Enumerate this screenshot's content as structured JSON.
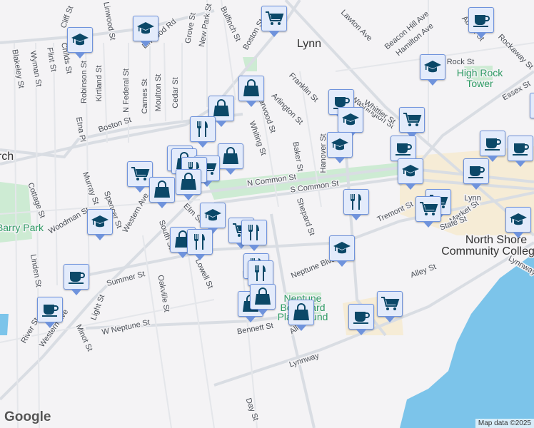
{
  "map": {
    "city_label": "Lynn",
    "landmark": [
      "High Rock",
      "Tower"
    ],
    "station": "Lynn",
    "college": [
      "North Shore",
      "Community College"
    ],
    "park_barry": "Barry Park",
    "playground": [
      "Neptune",
      "Boulevard",
      "Playground"
    ],
    "church_partial": "rch",
    "streets": [
      "Boston St",
      "Boston St",
      "N Common St",
      "S Common St",
      "Western Ave",
      "Summer St",
      "Neptune Blvd",
      "Lynnway",
      "Lynnway",
      "W Neptune St",
      "Bennett St",
      "Alley St",
      "Alley St",
      "Washington St",
      "Essex St",
      "Whittier St",
      "Franklin St",
      "Arlington St",
      "Harwood St",
      "Whiting St",
      "Baker St",
      "Hanover St",
      "Shepard St",
      "Lawton Ave",
      "Beacon Hill Ave",
      "Hamilton Ave",
      "Acorn St",
      "Rock St",
      "Rockaway St",
      "Cliff St",
      "Linwood St",
      "Linwood Rd",
      "Grove St",
      "New Park St",
      "Bulfinch St",
      "Childs St",
      "Blakeley St",
      "Wyman St",
      "Flint St",
      "Robinson St",
      "Kirtland St",
      "N Federal St",
      "Carnes St",
      "Moulton St",
      "Cedar St",
      "Etna Pl",
      "Cottage St",
      "Murray St",
      "Spencer St",
      "Woodman St",
      "South St",
      "Elm St",
      "Lowell St",
      "Oakville St",
      "Light St",
      "Minot St",
      "Western Ave",
      "River St",
      "Linden St",
      "Day St",
      "Market St",
      "State St",
      "Tremont St"
    ]
  },
  "markers": [
    "school",
    "school",
    "cart",
    "coffee",
    "school",
    "bag",
    "bag",
    "restaurant",
    "bag",
    "coffee",
    "school",
    "school",
    "cart",
    "coffee",
    "school",
    "coffee",
    "coffee",
    "coffee",
    "cart",
    "bag",
    "bag",
    "cart",
    "restaurant",
    "bag",
    "bag",
    "school",
    "restaurant",
    "cart",
    "cart",
    "school",
    "bag",
    "restaurant",
    "cart",
    "restaurant",
    "school",
    "restaurant",
    "restaurant",
    "coffee",
    "coffee",
    "bag",
    "bag",
    "bag",
    "coffee",
    "cart",
    "school",
    "coffee"
  ],
  "colors": {
    "icon": "#0b4868",
    "water": "#7cc4ea",
    "park": "#cdebd3"
  },
  "attribution": "Map data ©2025",
  "logo": "Google"
}
